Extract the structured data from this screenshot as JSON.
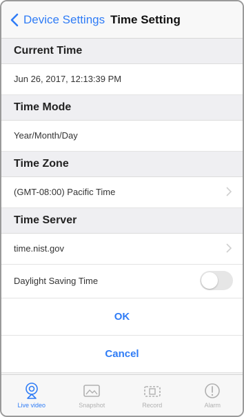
{
  "nav": {
    "back_label": "Device Settings",
    "title": "Time Setting"
  },
  "sections": {
    "current_time": {
      "header": "Current Time",
      "value": "Jun 26, 2017, 12:13:39 PM"
    },
    "time_mode": {
      "header": "Time Mode",
      "value": "Year/Month/Day"
    },
    "time_zone": {
      "header": "Time Zone",
      "value": "(GMT-08:00) Pacific Time"
    },
    "time_server": {
      "header": "Time Server",
      "value": "time.nist.gov"
    }
  },
  "daylight": {
    "label": "Daylight Saving Time",
    "enabled": false
  },
  "actions": {
    "ok": "OK",
    "cancel": "Cancel"
  },
  "tabbar": {
    "tabs": [
      {
        "label": "Live video",
        "icon": "camera-icon",
        "active": true
      },
      {
        "label": "Snapshot",
        "icon": "image-icon",
        "active": false
      },
      {
        "label": "Record",
        "icon": "video-icon",
        "active": false
      },
      {
        "label": "Alarm",
        "icon": "alert-icon",
        "active": false
      }
    ]
  },
  "colors": {
    "accent": "#2f7cf6",
    "section_bg": "#efeff2",
    "inactive_tab": "#b0b0b0"
  }
}
